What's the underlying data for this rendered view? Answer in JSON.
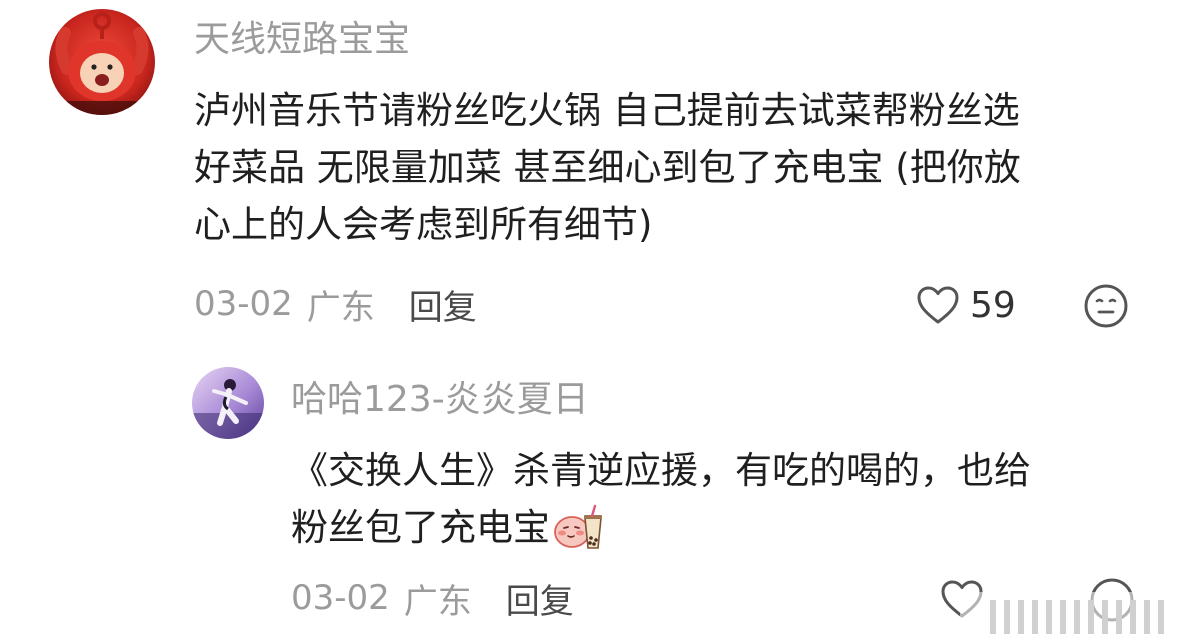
{
  "comments": [
    {
      "username": "天线短路宝宝",
      "text_lines": [
        "泸州音乐节请粉丝吃火锅 自己提前去试菜帮粉丝选",
        "好菜品 无限量加菜 甚至细心到包了充电宝 (把你放",
        "心上的人会考虑到所有细节)"
      ],
      "date": "03-02",
      "location": "广东",
      "reply_label": "回复",
      "like_count": "59",
      "avatar_icon": "teletubby-po-avatar"
    },
    {
      "username": "哈哈123-炎炎夏日",
      "text_lines": [
        "《交换人生》杀青逆应援，有吃的喝的，也给",
        "粉丝包了充电宝"
      ],
      "emoji": "bubble-tea-emoji",
      "date": "03-02",
      "location": "广东",
      "reply_label": "回复",
      "like_count": "",
      "avatar_icon": "dancer-avatar"
    }
  ],
  "colors": {
    "meta_gray": "#9b9b9b",
    "body_text": "#1f1f1f",
    "icon_gray": "#555555",
    "avatar_red": "#d8332a"
  }
}
